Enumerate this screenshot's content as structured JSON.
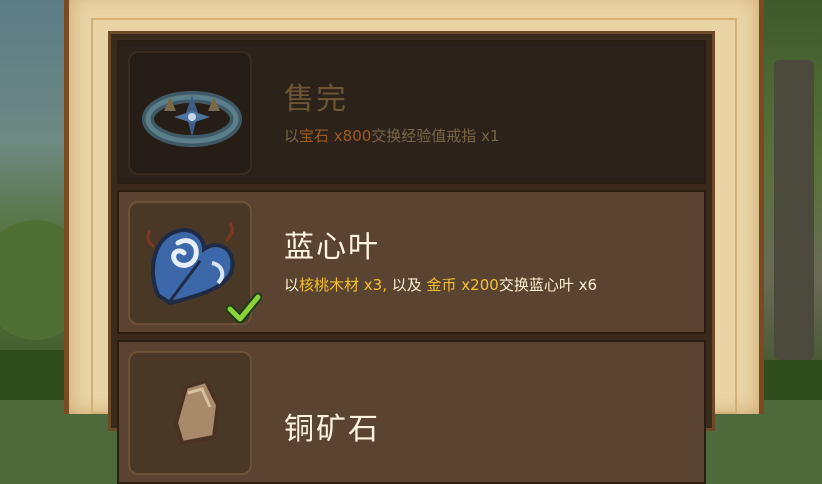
{
  "items": [
    {
      "title": "售完",
      "desc": {
        "pre": "以",
        "cost1": "宝石 x800",
        "post": "交换经验值戒指 x1"
      },
      "icon": "ring-icon",
      "state": "sold-out"
    },
    {
      "title": "蓝心叶",
      "desc": {
        "pre": "以",
        "cost1": "核桃木材 x3,",
        "mid": " 以及 ",
        "cost2": "金币 x200",
        "post": "交换蓝心叶 x6"
      },
      "icon": "blue-heart-leaf-icon",
      "state": "affordable"
    },
    {
      "title": "铜矿石",
      "icon": "copper-ore-icon",
      "state": "partially-visible"
    }
  ],
  "colors": {
    "highlight_active": "#f4c02c",
    "highlight_inactive": "#9a5b22",
    "panel": "#5a4431",
    "parchment": "#ead3a5"
  }
}
